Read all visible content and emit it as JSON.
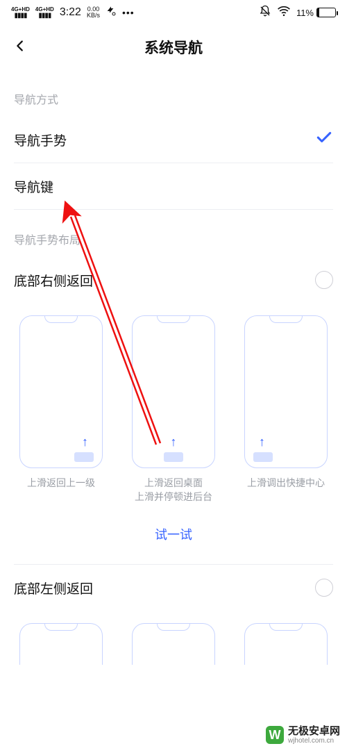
{
  "status": {
    "signal1": "4G+HD",
    "signal2": "4G+HD",
    "time": "3:22",
    "speed_value": "0.00",
    "speed_unit": "KB/s",
    "battery_pct": "11%"
  },
  "header": {
    "title": "系统导航"
  },
  "sections": {
    "nav_mode_label": "导航方式",
    "gesture_layout_label": "导航手势布局"
  },
  "nav_options": {
    "gesture": "导航手势",
    "keys": "导航键"
  },
  "layouts": {
    "right": {
      "title": "底部右侧返回",
      "previews": {
        "p1": "上滑返回上一级",
        "p2": "上滑返回桌面\n上滑并停顿进后台",
        "p3": "上滑调出快捷中心"
      },
      "try_label": "试一试"
    },
    "left": {
      "title": "底部左侧返回"
    }
  },
  "watermark": {
    "name": "无极安卓网",
    "url": "wjhotel.com.cn"
  }
}
